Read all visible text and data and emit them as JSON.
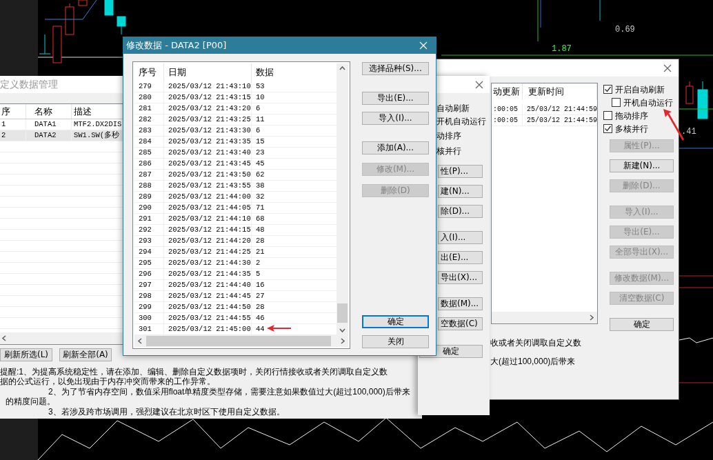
{
  "chart": {
    "labels": [
      {
        "text": "0.69",
        "color": "#c8c8c8"
      },
      {
        "text": "1.87",
        "color": "#33ff33"
      },
      {
        "text": ".41",
        "color": "#c8c8c8"
      }
    ]
  },
  "manager": {
    "title": "定义数据管理",
    "columns": [
      "序",
      "名称",
      "描述"
    ],
    "rows": [
      {
        "cells": [
          "1",
          "DATA1",
          "MTF2.DX2DIS"
        ],
        "selected": false
      },
      {
        "cells": [
          "2",
          "DATA2",
          "SW1.SW(多秒"
        ],
        "selected": true
      }
    ],
    "buttons": [
      "刷新所选(L)",
      "刷新全部(A)"
    ],
    "notes": [
      {
        "lines": [
          "提醒:1、为提高系统稳定性，请在添加、编辑、删除自定义数据项时，关闭行情接收或者关闭调取自定义数",
          "据的公式运行，以免出现由于内存冲突而带来的工作异常。"
        ]
      },
      {
        "lines": [
          "2、为了节省内存空间，数值采用float单精度类型存储，需要注意如果数值过大(超过100,000)后带来",
          "的精度问题。"
        ]
      },
      {
        "lines": [
          "3、若涉及跨市场调用，强烈建议在北京时区下使用自定义数据。"
        ]
      }
    ]
  },
  "manager_copy": {
    "options": [
      "自动刷新",
      "开机自动运行",
      "动排序",
      "核并行"
    ],
    "button_groups": [
      [
        "性(P)...",
        "建(N)...",
        "除(D)..."
      ],
      [
        "入(I)...",
        "出(E)...",
        "导出(X)..."
      ],
      [
        "数据(M)...",
        "空数据(C)"
      ],
      [
        "确定"
      ]
    ]
  },
  "manager_back": {
    "columns": [
      "动更新",
      "更新时间"
    ],
    "rows": [
      [
        ":00:05",
        "25/03/12 21:44:59"
      ],
      [
        ":00:05",
        "25/03/12 21:44:59"
      ]
    ],
    "options": [
      {
        "label": "开启自动刷新",
        "checked": true,
        "children": [
          {
            "label": "开机自动运行",
            "checked": false
          }
        ]
      },
      {
        "label": "拖动排序",
        "checked": false
      },
      {
        "label": "多核并行",
        "checked": true
      }
    ],
    "button_groups": [
      [
        {
          "label": "属性(P)...",
          "disabled": true
        },
        {
          "label": "新建(N)...",
          "disabled": false
        },
        {
          "label": "删除(D)...",
          "disabled": true
        }
      ],
      [
        {
          "label": "导入(I)...",
          "disabled": true
        },
        {
          "label": "导出(E)...",
          "disabled": true
        },
        {
          "label": "全部导出(X)...",
          "disabled": true
        }
      ],
      [
        {
          "label": "修改数据(M)...",
          "disabled": true
        },
        {
          "label": "清空数据(C)",
          "disabled": true
        }
      ],
      [
        {
          "label": "确定",
          "disabled": false
        }
      ]
    ],
    "notes": [
      "收或者关闭调取自定义数",
      "大(超过100,000)后带来"
    ]
  },
  "modal": {
    "title": "修改数据 - DATA2 [P00]",
    "columns": [
      "序号",
      "日期",
      "数据"
    ],
    "rows": [
      [
        "279",
        "2025/03/12 21:43:10",
        "53"
      ],
      [
        "280",
        "2025/03/12 21:43:15",
        "10"
      ],
      [
        "281",
        "2025/03/12 21:43:20",
        "6"
      ],
      [
        "282",
        "2025/03/12 21:43:25",
        "11"
      ],
      [
        "283",
        "2025/03/12 21:43:30",
        "6"
      ],
      [
        "284",
        "2025/03/12 21:43:35",
        "15"
      ],
      [
        "285",
        "2025/03/12 21:43:40",
        "23"
      ],
      [
        "286",
        "2025/03/12 21:43:45",
        "45"
      ],
      [
        "287",
        "2025/03/12 21:43:50",
        "62"
      ],
      [
        "288",
        "2025/03/12 21:43:55",
        "38"
      ],
      [
        "289",
        "2025/03/12 21:44:00",
        "32"
      ],
      [
        "290",
        "2025/03/12 21:44:05",
        "71"
      ],
      [
        "291",
        "2025/03/12 21:44:10",
        "68"
      ],
      [
        "292",
        "2025/03/12 21:44:15",
        "48"
      ],
      [
        "293",
        "2025/03/12 21:44:20",
        "28"
      ],
      [
        "294",
        "2025/03/12 21:44:25",
        "21"
      ],
      [
        "295",
        "2025/03/12 21:44:30",
        "2"
      ],
      [
        "296",
        "2025/03/12 21:44:35",
        "5"
      ],
      [
        "297",
        "2025/03/12 21:44:40",
        "16"
      ],
      [
        "298",
        "2025/03/12 21:44:45",
        "27"
      ],
      [
        "299",
        "2025/03/12 21:44:50",
        "28"
      ],
      [
        "300",
        "2025/03/12 21:44:55",
        "46"
      ],
      [
        "301",
        "2025/03/12 21:45:00",
        "44"
      ]
    ],
    "button_groups": [
      [
        {
          "label": "选择品种(S)...",
          "disabled": false,
          "focused": false
        }
      ],
      [
        {
          "label": "导出(E)...",
          "disabled": false,
          "focused": false
        },
        {
          "label": "导入(I)...",
          "disabled": false,
          "focused": false
        }
      ],
      [
        {
          "label": "添加(A)...",
          "disabled": false,
          "focused": false
        },
        {
          "label": "修改(M)...",
          "disabled": true,
          "focused": false
        },
        {
          "label": "删除(D)",
          "disabled": true,
          "focused": false
        }
      ],
      [
        {
          "label": "确定",
          "disabled": false,
          "focused": true
        },
        {
          "label": "关闭",
          "disabled": false,
          "focused": false
        }
      ]
    ]
  }
}
